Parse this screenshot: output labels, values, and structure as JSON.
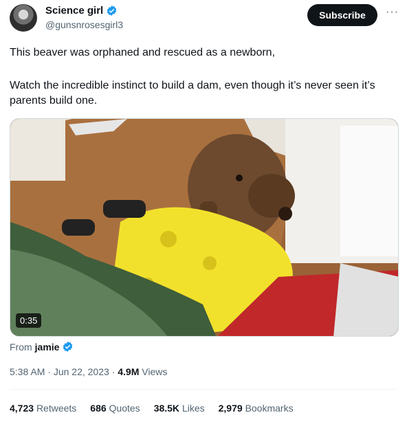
{
  "author": {
    "name": "Science girl",
    "handle": "@gunsnrosesgirl3"
  },
  "actions": {
    "subscribe_label": "Subscribe",
    "more_label": "···"
  },
  "tweet": {
    "line1": "This beaver was orphaned and rescued as a newborn,",
    "line2": "Watch the incredible instinct to build a dam, even though it’s never seen it’s parents build one."
  },
  "media": {
    "duration": "0:35"
  },
  "attribution": {
    "prefix": "From",
    "source": "jamie"
  },
  "meta": {
    "time": "5:38 AM",
    "separator1": "·",
    "date": "Jun 22, 2023",
    "separator2": "·",
    "views_count": "4.9M",
    "views_label": "Views"
  },
  "stats": [
    {
      "count": "4,723",
      "label": "Retweets"
    },
    {
      "count": "686",
      "label": "Quotes"
    },
    {
      "count": "38.5K",
      "label": "Likes"
    },
    {
      "count": "2,979",
      "label": "Bookmarks"
    }
  ],
  "colors": {
    "verified": "#1d9bf0",
    "muted": "#536471",
    "text": "#0f1419"
  }
}
